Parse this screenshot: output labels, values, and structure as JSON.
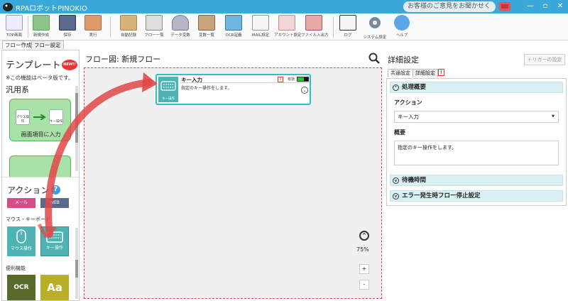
{
  "app": {
    "title": "RPAロボットPINOKIO",
    "feedback_text": "お客様のご意見をお聞かせください"
  },
  "window": {
    "minimize": "—",
    "maximize": "▫",
    "close": "✕"
  },
  "toolbar": {
    "buttons": [
      {
        "label": "TOP画面"
      },
      {
        "label": "新規作成"
      },
      {
        "label": "保存"
      },
      {
        "label": "実行"
      },
      {
        "label": "自動記録"
      },
      {
        "label": "フロー一覧"
      },
      {
        "label": "データ変数"
      },
      {
        "label": "変数一覧"
      },
      {
        "label": "OCR定義"
      },
      {
        "label": "MAIL設定"
      },
      {
        "label": "アカウント設定"
      },
      {
        "label": "ファイル入出力"
      },
      {
        "label": "ログ"
      },
      {
        "label": "システム設定"
      },
      {
        "label": "ヘルプ"
      }
    ]
  },
  "tabs": [
    {
      "label": "フロー作成"
    },
    {
      "label": "フロー設定"
    }
  ],
  "templates": {
    "title": "テンプレート",
    "new_badge": "NEW!!",
    "beta_note": "※この機能はベータ版です。",
    "category": "汎用系",
    "card_text": "画面項目に入力",
    "mouse_caption": "マウス操作",
    "key_caption": "キー操作"
  },
  "actions": {
    "title": "アクション",
    "help": "?",
    "mail_label": "メール",
    "web_label": "WEB",
    "mouse_section": "マウス・キーボード",
    "mouse_tile": "マウス操作",
    "key_tile": "キー操作",
    "util_section": "便利機能",
    "ocr_tile": "OCR",
    "font_tile": "Aa"
  },
  "flow": {
    "header": "フロー図:  新規フロー",
    "node": {
      "title": "キー入力",
      "desc": "指定のキー操作をします。",
      "icon_caption": "キー操作",
      "warn": "!",
      "enabled_label": "有効",
      "expand": "⌄"
    },
    "zoom_level": "75%",
    "zoom_in": "+",
    "zoom_out": "-",
    "zoom_up": "^"
  },
  "details": {
    "title": "詳細設定",
    "trigger_button": "トリガーの設定",
    "tabs": [
      {
        "label": "共通設定"
      },
      {
        "label": "詳細設定"
      }
    ],
    "tab_warn": "!",
    "section1": "処理概要",
    "action_label": "アクション",
    "action_value": "キー入力",
    "summary_label": "概要",
    "summary_value": "指定のキー操作をします。",
    "section2": "待機時間",
    "section3": "エラー発生時フロー停止設定"
  },
  "colors": {
    "titlebar": "#3aa8d8",
    "accent": "#2ec1c6",
    "tile": "#4fb3b3",
    "arrow": "#e04848",
    "card": "#a8e2a8"
  }
}
